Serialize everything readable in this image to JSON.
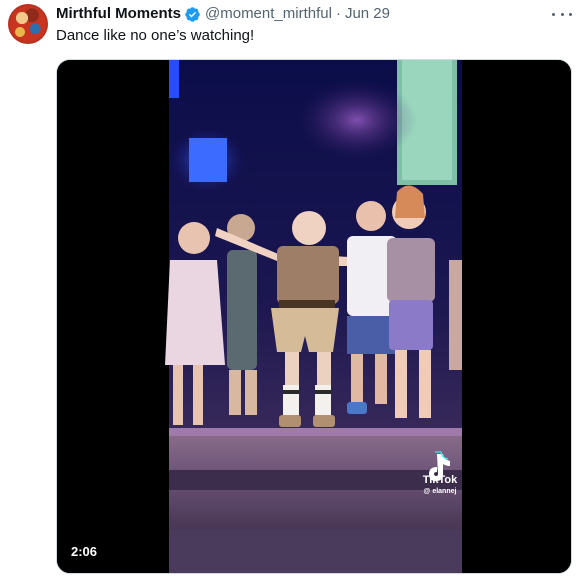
{
  "author": {
    "name": "Mirthful Moments",
    "handle": "@moment_mirthful",
    "separator": "·",
    "date": "Jun 29",
    "verified": true,
    "verified_color": "#1d9bf0",
    "avatar_icon": "avatar"
  },
  "tweet": {
    "text": "Dance like no one’s watching!"
  },
  "media": {
    "type": "video",
    "duration": "2:06",
    "watermark": {
      "brand": "TikTok",
      "handle": "@ elannej"
    }
  },
  "icons": {
    "more": "more-dots-icon",
    "verified": "verified-badge-icon",
    "tiktok": "tiktok-logo-icon"
  }
}
